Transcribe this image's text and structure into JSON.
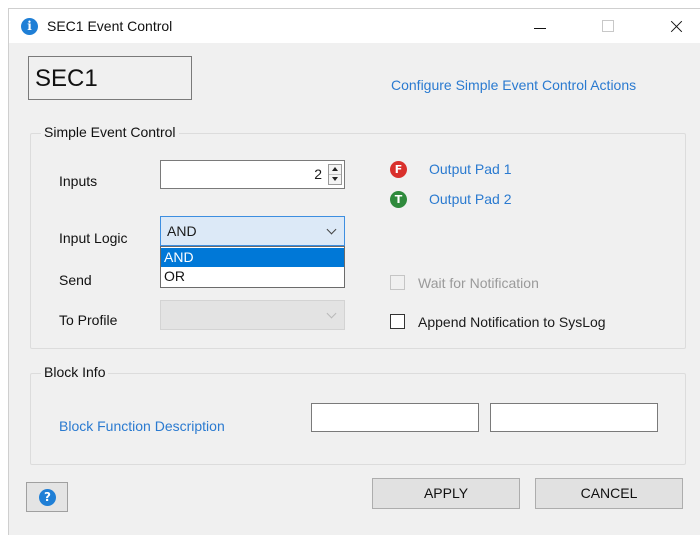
{
  "window": {
    "title": "SEC1 Event Control",
    "app_icon": "info-icon",
    "controls": [
      "minimize",
      "maximize",
      "close"
    ]
  },
  "header": {
    "name_value": "SEC1",
    "config_link": "Configure Simple Event Control Actions"
  },
  "sec_group": {
    "legend": "Simple Event Control",
    "inputs_label": "Inputs",
    "inputs_value": "2",
    "input_logic_label": "Input Logic",
    "input_logic_value": "AND",
    "input_logic_options": [
      "AND",
      "OR"
    ],
    "send_label": "Send",
    "to_profile_label": "To Profile",
    "to_profile_value": "",
    "output_pads": [
      {
        "icon_letter": "F",
        "label": "Output Pad 1",
        "color": "#d9302c"
      },
      {
        "icon_letter": "T",
        "label": "Output Pad 2",
        "color": "#2f8a3c"
      }
    ],
    "wait_label": "Wait for Notification",
    "wait_checked": false,
    "wait_enabled": false,
    "append_label": "Append Notification to SysLog",
    "append_checked": false
  },
  "block_group": {
    "legend": "Block Info",
    "description_link": "Block Function Description",
    "field1_value": "",
    "field2_value": ""
  },
  "footer": {
    "help_icon": "help-icon",
    "apply_label": "APPLY",
    "cancel_label": "CANCEL"
  },
  "colors": {
    "link": "#2a7ad0",
    "selection": "#0078d7",
    "dialog_bg": "#f0f0f0"
  }
}
